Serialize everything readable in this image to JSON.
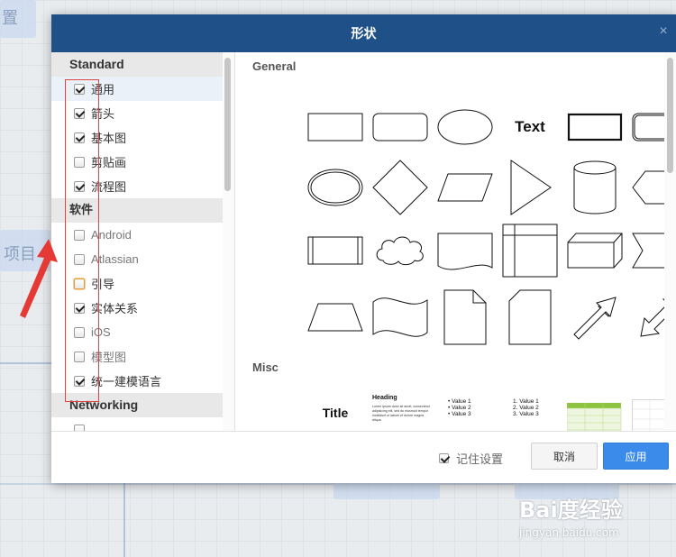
{
  "background": {
    "text_fragment_1": "置",
    "text_fragment_2": "项目"
  },
  "dialog": {
    "title": "形状",
    "close_glyph": "×",
    "accent_color": "#1f5188"
  },
  "left_panel": {
    "sections": [
      {
        "title": "Standard",
        "items": [
          {
            "label": "通用",
            "checked": true
          },
          {
            "label": "箭头",
            "checked": true
          },
          {
            "label": "基本图",
            "checked": true
          },
          {
            "label": "剪贴画",
            "checked": false
          },
          {
            "label": "流程图",
            "checked": true
          }
        ]
      },
      {
        "title": "软件",
        "items": [
          {
            "label": "Android",
            "checked": false
          },
          {
            "label": "Atlassian",
            "checked": false
          },
          {
            "label": "引导",
            "checked": false
          },
          {
            "label": "实体关系",
            "checked": true
          },
          {
            "label": "iOS",
            "checked": false
          },
          {
            "label": "模型图",
            "checked": false
          },
          {
            "label": "统一建模语言",
            "checked": true
          }
        ]
      },
      {
        "title": "Networking",
        "items": []
      }
    ]
  },
  "right_panel": {
    "groups": [
      {
        "title": "General"
      },
      {
        "title": "Misc"
      }
    ],
    "general_shapes": [
      "rectangle-icon",
      "rounded-rectangle-icon",
      "ellipse-icon",
      "text-shape-icon",
      "thick-rectangle-icon",
      "double-rounded-rectangle-icon",
      "double-ellipse-icon",
      "diamond-icon",
      "parallelogram-icon",
      "triangle-icon",
      "cylinder-icon",
      "hexagon-icon",
      "process-icon",
      "cloud-icon",
      "document-icon",
      "internal-storage-icon",
      "cube-icon",
      "step-icon",
      "trapezoid-icon",
      "tape-icon",
      "note-icon",
      "card-icon",
      "arrow-icon",
      "double-arrow-icon"
    ],
    "text_shape_label": "Text",
    "misc_shapes": {
      "title_label": "Title",
      "heading_label": "Heading",
      "heading_body": "Lorem ipsum dolor sit amet, consectetur adipisicing elit, sed do eiusmod tempor incididunt ut labore et dolore magna aliqua.",
      "bullets": [
        "Value 1",
        "Value 2",
        "Value 3"
      ],
      "numbered": [
        "Value 1",
        "Value 2",
        "Value 3"
      ],
      "table_label": "VALUE",
      "table_accent": "#8cc43f"
    }
  },
  "footer": {
    "remember_label": "记住设置",
    "remember_checked": true,
    "cancel_label": "取消",
    "apply_label": "应用",
    "apply_color": "#3b8bea"
  },
  "watermark": {
    "logo_text": "Bai度经验",
    "url": "jingyan.baidu.com"
  }
}
